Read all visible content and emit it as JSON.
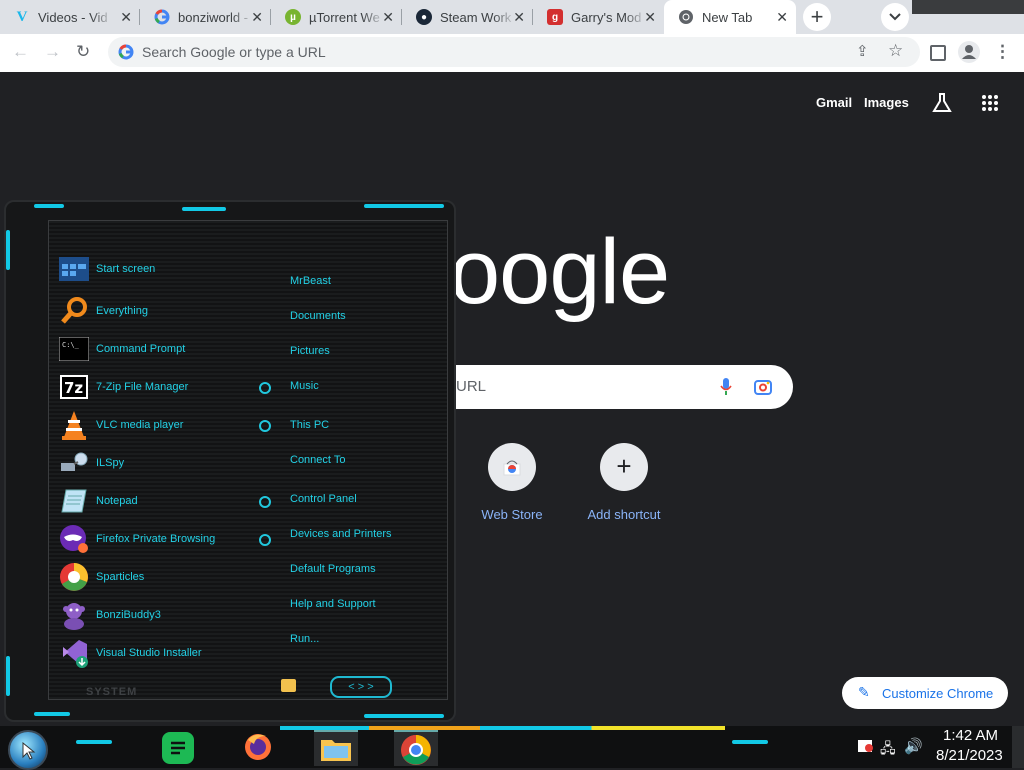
{
  "tabs": [
    {
      "title": "Videos - Vid",
      "icon": "vimeo-icon",
      "color": "#1ab7ea"
    },
    {
      "title": "bonziworld -",
      "icon": "google-icon",
      "color": "#4285f4"
    },
    {
      "title": "µTorrent We",
      "icon": "utorrent-icon",
      "color": "#78b431"
    },
    {
      "title": "Steam Work",
      "icon": "steam-icon",
      "color": "#1b2838"
    },
    {
      "title": "Garry's Mod",
      "icon": "garrysmod-icon",
      "color": "#d32f2f"
    },
    {
      "title": "New Tab",
      "icon": "chrome-icon",
      "color": "#4285f4"
    }
  ],
  "toolbar": {
    "omnibox_placeholder": "Search Google or type a URL"
  },
  "newtab": {
    "links": {
      "gmail": "Gmail",
      "images": "Images"
    },
    "logo_text": "oogle",
    "search_placeholder": "URL",
    "shortcuts": [
      {
        "label": "Web Store"
      },
      {
        "label": "Add shortcut"
      }
    ],
    "customize_label": "Customize Chrome"
  },
  "start_menu": {
    "programs": [
      {
        "label": "Start screen",
        "icon": "start-screen-icon"
      },
      {
        "label": "Everything",
        "icon": "everything-search-icon"
      },
      {
        "label": "Command Prompt",
        "icon": "command-prompt-icon"
      },
      {
        "label": "7-Zip File Manager",
        "icon": "7zip-icon"
      },
      {
        "label": "VLC media player",
        "icon": "vlc-icon"
      },
      {
        "label": "ILSpy",
        "icon": "ilspy-icon"
      },
      {
        "label": "Notepad",
        "icon": "notepad-icon"
      },
      {
        "label": "Firefox Private Browsing",
        "icon": "firefox-private-icon"
      },
      {
        "label": "Sparticles",
        "icon": "sparticles-icon"
      },
      {
        "label": "BonziBuddy3",
        "icon": "bonzibuddy-icon"
      },
      {
        "label": "Visual Studio Installer",
        "icon": "vs-installer-icon"
      }
    ],
    "places": [
      {
        "label": "MrBeast"
      },
      {
        "label": "Documents"
      },
      {
        "label": "Pictures"
      },
      {
        "label": "Music"
      },
      {
        "label": "This PC"
      },
      {
        "label": "Connect To"
      },
      {
        "label": "Control Panel"
      },
      {
        "label": "Devices and Printers"
      },
      {
        "label": "Default Programs"
      },
      {
        "label": "Help and Support"
      },
      {
        "label": "Run..."
      }
    ],
    "footer_label": "SYSTEM"
  },
  "taskbar": {
    "apps": [
      {
        "icon": "notes-app-icon"
      },
      {
        "icon": "firefox-icon"
      },
      {
        "icon": "file-explorer-icon"
      },
      {
        "icon": "chrome-icon"
      }
    ],
    "time": "1:42 AM",
    "date": "8/21/2023"
  },
  "colors": {
    "accent": "#23d1e6",
    "chrome_dark": "#202124",
    "tab_strip": "#dee1e6"
  }
}
